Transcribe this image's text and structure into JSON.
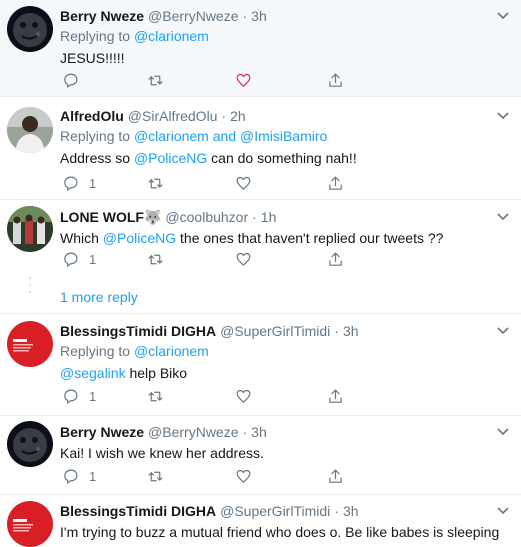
{
  "tweets": [
    {
      "name": "Berry Nweze",
      "handle": "@BerryNweze",
      "dot": "·",
      "time": "3h",
      "replying_prefix": "Replying to",
      "replying_users": [
        "@clarionem"
      ],
      "replying_join": "",
      "text_parts": [
        {
          "t": "JESUS!!!!!",
          "m": false
        }
      ],
      "reply_count": "",
      "avatar": "moon",
      "like_highlight": true
    },
    {
      "name": "AlfredOlu",
      "handle": "@SirAlfredOlu",
      "dot": "·",
      "time": "2h",
      "replying_prefix": "Replying to",
      "replying_users": [
        "@clarionem",
        "@ImisiBamiro"
      ],
      "replying_join": "and",
      "text_parts": [
        {
          "t": "Address so ",
          "m": false
        },
        {
          "t": "@PoliceNG",
          "m": true
        },
        {
          "t": " can do something nah!!",
          "m": false
        }
      ],
      "reply_count": "1",
      "avatar": "man"
    },
    {
      "name": "LONE WOLF🐺",
      "handle": "@coolbuhzor",
      "dot": "·",
      "time": "1h",
      "replying_prefix": "",
      "replying_users": [],
      "replying_join": "",
      "text_parts": [
        {
          "t": "Which ",
          "m": false
        },
        {
          "t": "@PoliceNG",
          "m": true
        },
        {
          "t": " the ones that haven't replied our tweets ??",
          "m": false
        }
      ],
      "reply_count": "1",
      "avatar": "group"
    },
    {
      "name": "BlessingsTimidi DIGHA",
      "handle": "@SuperGirlTimidi",
      "dot": "·",
      "time": "3h",
      "replying_prefix": "Replying to",
      "replying_users": [
        "@clarionem"
      ],
      "replying_join": "",
      "text_parts": [
        {
          "t": "@segalink",
          "m": true
        },
        {
          "t": " help Biko",
          "m": false
        }
      ],
      "reply_count": "1",
      "avatar": "stop"
    },
    {
      "name": "Berry Nweze",
      "handle": "@BerryNweze",
      "dot": "·",
      "time": "3h",
      "replying_prefix": "",
      "replying_users": [],
      "replying_join": "",
      "text_parts": [
        {
          "t": "Kai! I wish we knew her address.",
          "m": false
        }
      ],
      "reply_count": "1",
      "avatar": "moon"
    },
    {
      "name": "BlessingsTimidi DIGHA",
      "handle": "@SuperGirlTimidi",
      "dot": "·",
      "time": "3h",
      "replying_prefix": "",
      "replying_users": [],
      "replying_join": "",
      "text_parts": [
        {
          "t": "I'm trying to buzz a mutual friend who does o. Be like babes is sleeping",
          "m": false
        }
      ],
      "reply_count": "",
      "avatar": "stop"
    }
  ],
  "more_replies_label": "1 more reply",
  "colors": {
    "accent": "#1da1f2",
    "muted": "#657786",
    "like_active": "#e0245e",
    "border": "#e6ecf0"
  }
}
